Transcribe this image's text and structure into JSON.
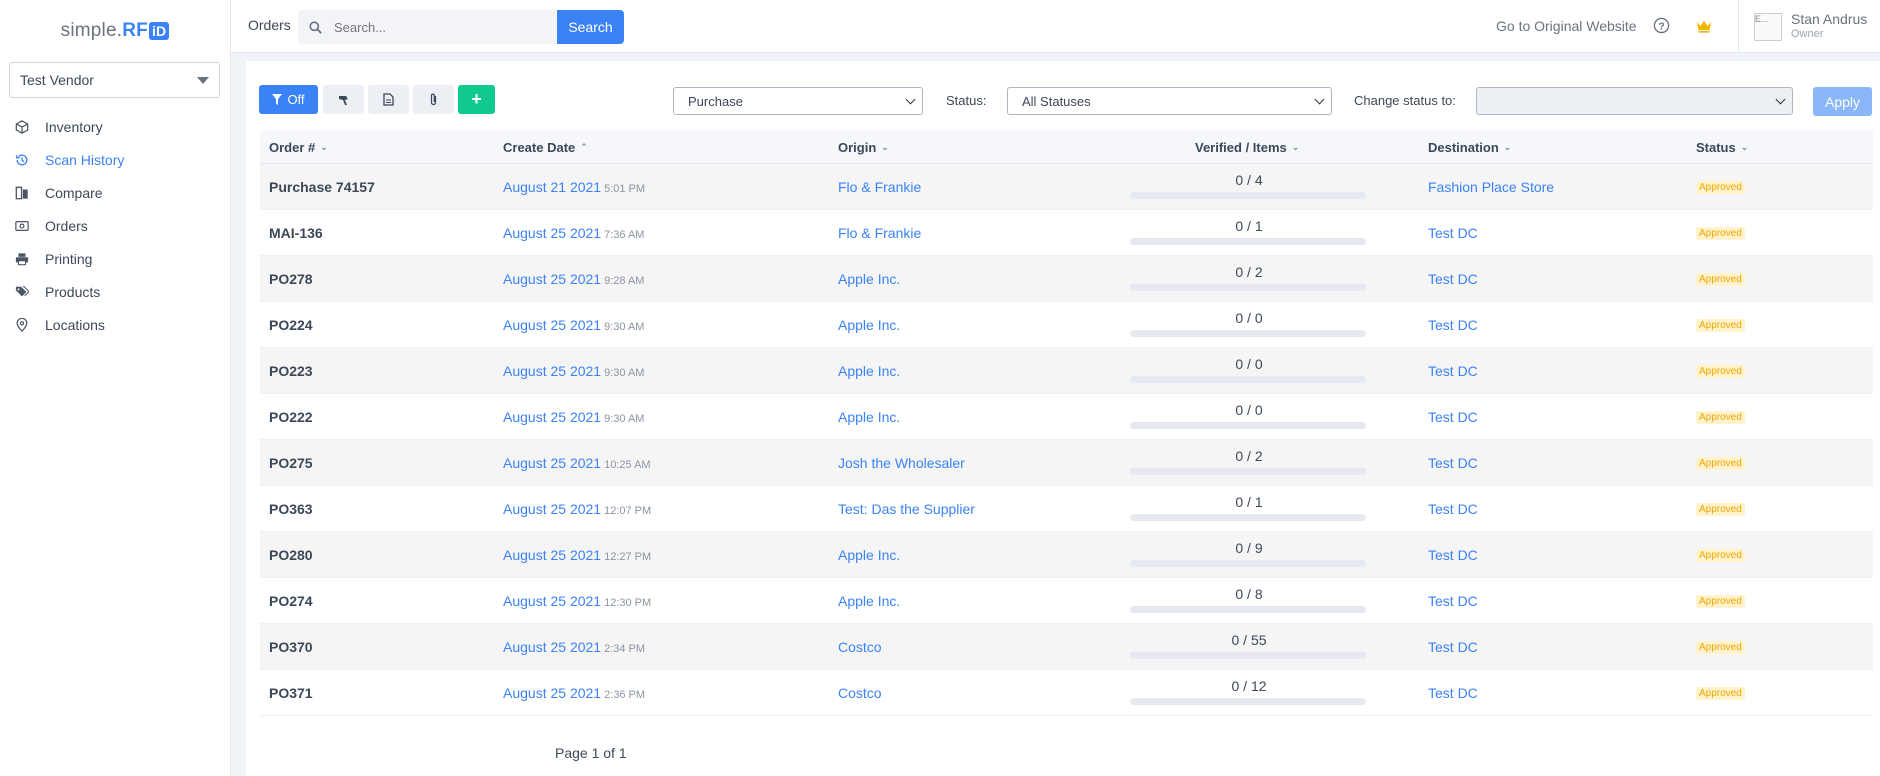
{
  "sidebar": {
    "logo": {
      "prefix": "simple.",
      "rf": "RF",
      "id": "iD"
    },
    "vendor": "Test Vendor",
    "items": [
      {
        "label": "Inventory",
        "icon": "box-icon"
      },
      {
        "label": "Scan History",
        "icon": "history-icon"
      },
      {
        "label": "Compare",
        "icon": "compare-icon"
      },
      {
        "label": "Orders",
        "icon": "orders-icon"
      },
      {
        "label": "Printing",
        "icon": "printer-icon"
      },
      {
        "label": "Products",
        "icon": "tags-icon"
      },
      {
        "label": "Locations",
        "icon": "location-pin-icon"
      }
    ],
    "active": "Scan History"
  },
  "header": {
    "title": "Orders",
    "search_placeholder": "Search...",
    "search_button": "Search",
    "go_link": "Go to Original Website",
    "user_name": "Stan Andrus",
    "user_role": "Owner",
    "avatar_alt": "E..."
  },
  "toolbar": {
    "filter_label": "Off",
    "order_type": "Purchase",
    "status_label": "Status:",
    "status_value": "All Statuses",
    "change_status_label": "Change status to:",
    "change_status_value": "",
    "apply_label": "Apply",
    "add_label": "+"
  },
  "table": {
    "columns": [
      "Order #",
      "Create Date",
      "Origin",
      "Verified / Items",
      "Destination",
      "Status"
    ],
    "rows": [
      {
        "order": "Purchase 74157",
        "date": "August 21 2021",
        "time": "5:01 PM",
        "origin": "Flo & Frankie",
        "verified": "0 / 4",
        "progress": 0,
        "destination": "Fashion Place Store",
        "status": "Approved"
      },
      {
        "order": "MAI-136",
        "date": "August 25 2021",
        "time": "7:36 AM",
        "origin": "Flo & Frankie",
        "verified": "0 / 1",
        "progress": 0,
        "destination": "Test DC",
        "status": "Approved"
      },
      {
        "order": "PO278",
        "date": "August 25 2021",
        "time": "9:28 AM",
        "origin": "Apple Inc.",
        "verified": "0 / 2",
        "progress": 0,
        "destination": "Test DC",
        "status": "Approved"
      },
      {
        "order": "PO224",
        "date": "August 25 2021",
        "time": "9:30 AM",
        "origin": "Apple Inc.",
        "verified": "0 / 0",
        "progress": 0,
        "destination": "Test DC",
        "status": "Approved"
      },
      {
        "order": "PO223",
        "date": "August 25 2021",
        "time": "9:30 AM",
        "origin": "Apple Inc.",
        "verified": "0 / 0",
        "progress": 0,
        "destination": "Test DC",
        "status": "Approved"
      },
      {
        "order": "PO222",
        "date": "August 25 2021",
        "time": "9:30 AM",
        "origin": "Apple Inc.",
        "verified": "0 / 0",
        "progress": 0,
        "destination": "Test DC",
        "status": "Approved"
      },
      {
        "order": "PO275",
        "date": "August 25 2021",
        "time": "10:25 AM",
        "origin": "Josh the Wholesaler",
        "verified": "0 / 2",
        "progress": 0,
        "destination": "Test DC",
        "status": "Approved"
      },
      {
        "order": "PO363",
        "date": "August 25 2021",
        "time": "12:07 PM",
        "origin": "Test: Das the Supplier",
        "verified": "0 / 1",
        "progress": 0,
        "destination": "Test DC",
        "status": "Approved"
      },
      {
        "order": "PO280",
        "date": "August 25 2021",
        "time": "12:27 PM",
        "origin": "Apple Inc.",
        "verified": "0 / 9",
        "progress": 0,
        "destination": "Test DC",
        "status": "Approved"
      },
      {
        "order": "PO274",
        "date": "August 25 2021",
        "time": "12:30 PM",
        "origin": "Apple Inc.",
        "verified": "0 / 8",
        "progress": 0,
        "destination": "Test DC",
        "status": "Approved"
      },
      {
        "order": "PO370",
        "date": "August 25 2021",
        "time": "2:34 PM",
        "origin": "Costco",
        "verified": "0 / 55",
        "progress": 0,
        "destination": "Test DC",
        "status": "Approved"
      },
      {
        "order": "PO371",
        "date": "August 25 2021",
        "time": "2:36 PM",
        "origin": "Costco",
        "verified": "0 / 12",
        "progress": 0,
        "destination": "Test DC",
        "status": "Approved"
      }
    ]
  },
  "pagination": "Page 1 of 1",
  "colors": {
    "accent": "#3b82f6",
    "green": "#10c98f",
    "badge_bg": "#fff3cd",
    "badge_text": "#f0a500"
  }
}
